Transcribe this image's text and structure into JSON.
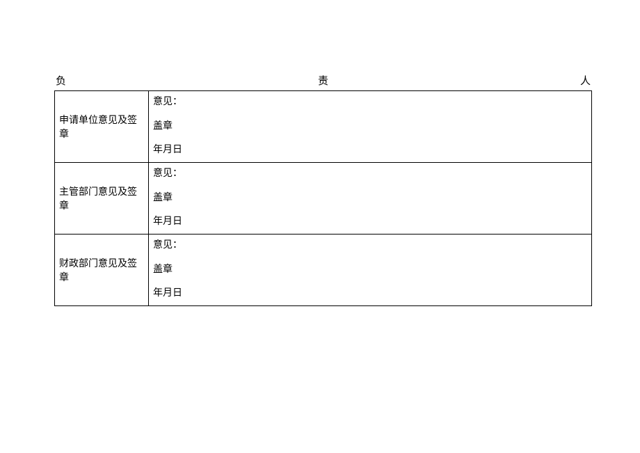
{
  "header": {
    "char1": "负",
    "char2": "责",
    "char3": "人"
  },
  "rows": [
    {
      "label": "申请单位意见及签章",
      "line1": "意见：",
      "line2": "盖章",
      "line3": "年月日"
    },
    {
      "label": "主管部门意见及签章",
      "line1": "意见：",
      "line2": "盖章",
      "line3": "年月日"
    },
    {
      "label": "财政部门意见及签章",
      "line1": "意见：",
      "line2": "盖章",
      "line3": "年月日"
    }
  ]
}
